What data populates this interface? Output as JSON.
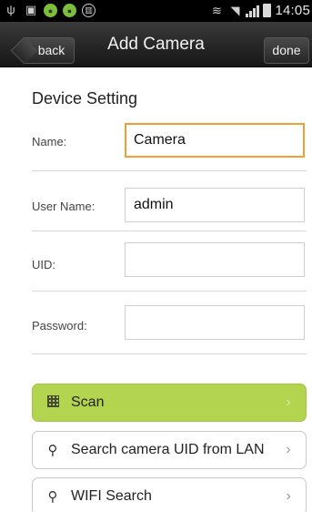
{
  "status_bar": {
    "time": "14:05",
    "left_icons": [
      "usb-icon",
      "screenshot-icon",
      "app-green-icon",
      "app-green-icon",
      "notification-icon"
    ],
    "right_icons": [
      "nfc-icon",
      "wifi-icon",
      "signal-icon",
      "battery-icon"
    ]
  },
  "header": {
    "title": "Add Camera",
    "back_label": "back",
    "done_label": "done"
  },
  "form": {
    "section_title": "Device Setting",
    "fields": [
      {
        "label": "Name:",
        "value": "Camera",
        "focused": true
      },
      {
        "label": "User Name:",
        "value": "admin",
        "focused": false
      },
      {
        "label": "UID:",
        "value": "",
        "focused": false
      },
      {
        "label": "Password:",
        "value": "",
        "focused": false
      }
    ]
  },
  "actions": [
    {
      "label": "Scan",
      "icon": "qr-code-icon",
      "color": "#b2d44e"
    },
    {
      "label": "Search camera UID from LAN",
      "icon": "search-icon",
      "color": "#ffffff"
    },
    {
      "label": "WIFI Search",
      "icon": "search-icon",
      "color": "#ffffff"
    }
  ]
}
